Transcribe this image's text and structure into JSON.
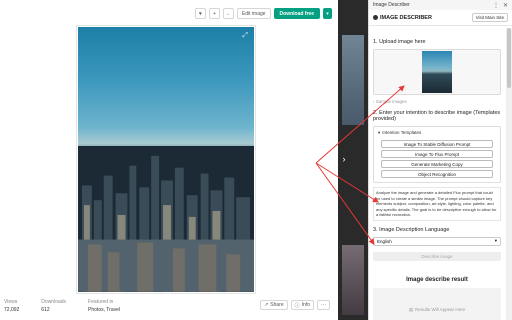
{
  "toolbar": {
    "heart_icon": "heart-icon",
    "edit_label": "Edit image",
    "download_label": "Download free"
  },
  "stats": [
    {
      "label": "Views",
      "value": "72,092"
    },
    {
      "label": "Downloads",
      "value": "612"
    },
    {
      "label": "Featured in",
      "value": "Photos, Travel"
    }
  ],
  "actions": {
    "share_label": "Share",
    "info_label": "Info",
    "more_label": "···"
  },
  "panel": {
    "window_title": "Image Describer",
    "brand": "IMAGE DESCRIBER",
    "visit_label": "Visit Main Site",
    "upload_title": "1. Upload image here",
    "sample_link": "Sample images",
    "intention_title": "2. Enter your intention to describe image (Templates provided)",
    "templates_header": "Intention Templates",
    "templates": [
      "Image To Stable Diffusion Prompt",
      "Image To Flux Prompt",
      "Generate Marketing Copy",
      "Object Recognition"
    ],
    "prompt_text": "Analyze the image and generate a detailed Flux prompt that could be used to create a similar image. The prompt should capture key elements subject, composition, art style, lighting, color palette, and any specific details. The goal is to be descriptive enough to allow for a faithful recreation.",
    "language_title": "3. Image Description Language",
    "language_value": "English",
    "describe_label": "Describe image",
    "result_title": "Image describe result",
    "result_placeholder": "Results Will Appear Here"
  },
  "colors": {
    "download_green": "#05a081",
    "arrow_red": "#e53935"
  }
}
